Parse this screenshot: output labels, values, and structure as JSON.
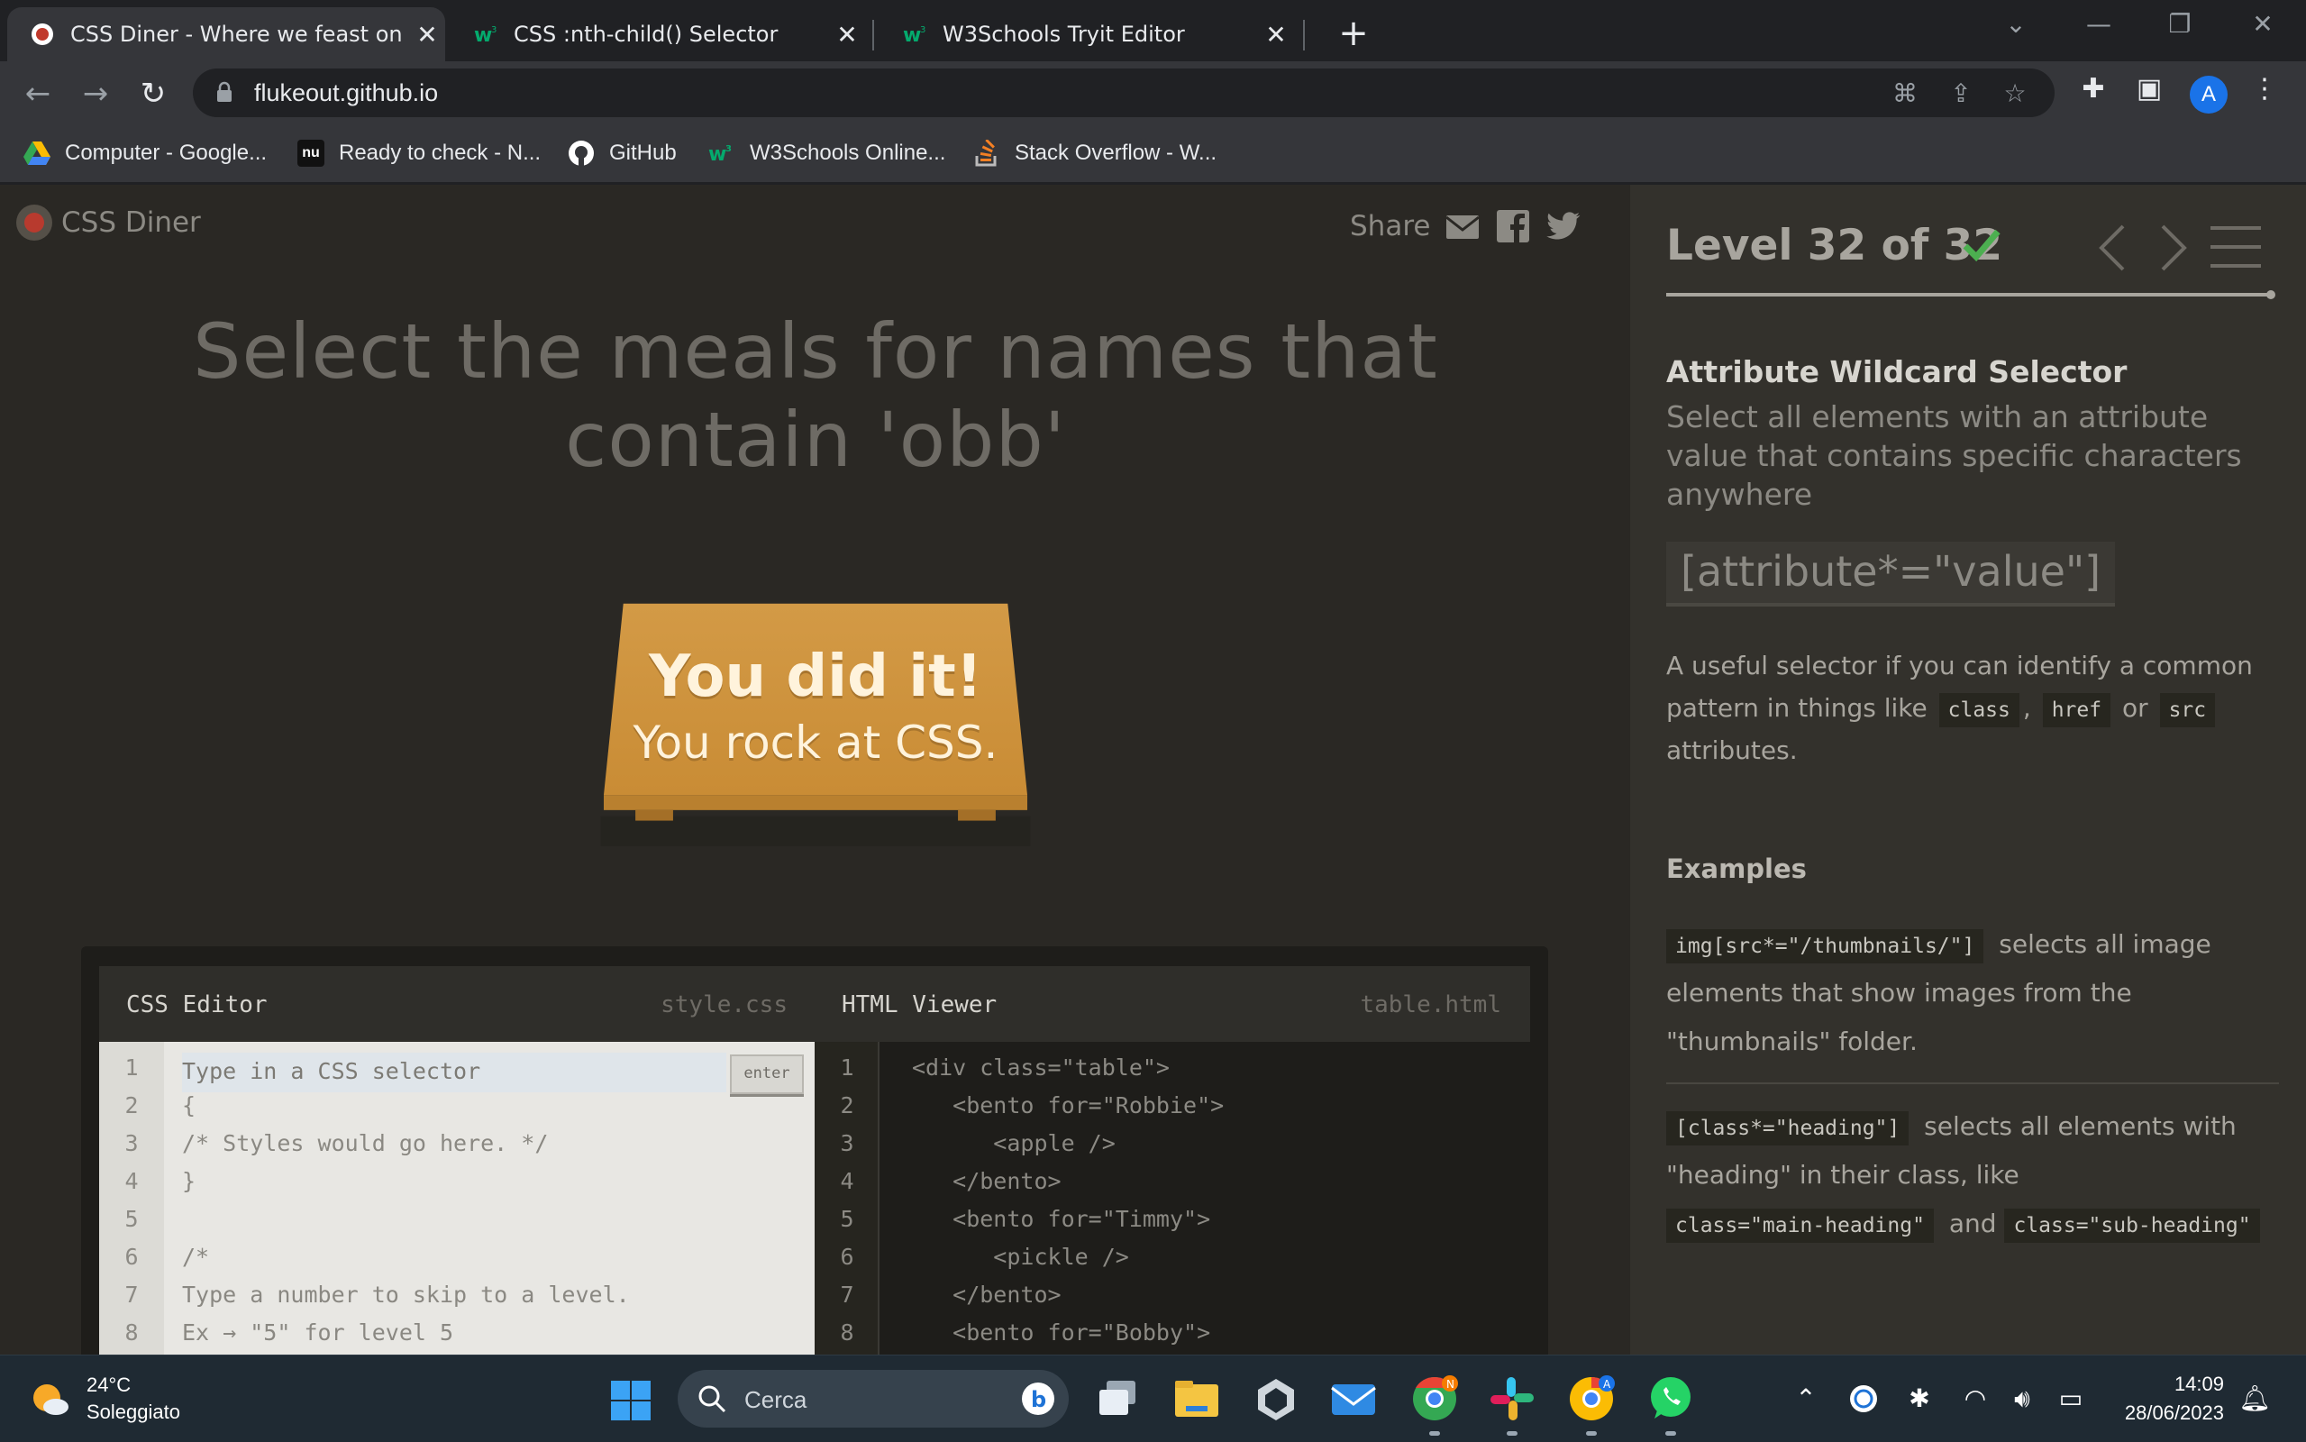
{
  "browser": {
    "tabs": [
      {
        "title": "CSS Diner - Where we feast on C",
        "active": true
      },
      {
        "title": "CSS :nth-child() Selector",
        "active": false
      },
      {
        "title": "W3Schools Tryit Editor",
        "active": false
      }
    ],
    "url": "flukeout.github.io",
    "profile_initial": "A",
    "bookmarks": [
      {
        "label": "Computer - Google..."
      },
      {
        "label": "Ready to check - N...",
        "icon_text": "nu"
      },
      {
        "label": "GitHub"
      },
      {
        "label": "W3Schools Online..."
      },
      {
        "label": "Stack Overflow - W..."
      }
    ]
  },
  "game": {
    "logo": "CSS Diner",
    "share_label": "Share",
    "instruction": "Select the meals for names that contain 'obb'",
    "success_title": "You did it!",
    "success_subtitle": "You rock at CSS.",
    "css_editor": {
      "title": "CSS Editor",
      "filename": "style.css",
      "placeholder": "Type in a CSS selector",
      "enter_label": "enter",
      "line_numbers": [
        "1",
        "2",
        "3",
        "4",
        "5",
        "6",
        "7",
        "8"
      ],
      "lines": [
        "",
        "{",
        "/* Styles would go here. */",
        "}",
        "",
        "/*",
        "Type a number to skip to a level.",
        "Ex → \"5\" for level 5"
      ]
    },
    "html_viewer": {
      "title": "HTML Viewer",
      "filename": "table.html",
      "line_numbers": [
        "1",
        "2",
        "3",
        "4",
        "5",
        "6",
        "7",
        "8"
      ],
      "lines": [
        "<div class=\"table\">",
        "   <bento for=\"Robbie\">",
        "      <apple />",
        "   </bento>",
        "   <bento for=\"Timmy\">",
        "      <pickle />",
        "   </bento>",
        "   <bento for=\"Bobby\">"
      ]
    }
  },
  "sidebar": {
    "level_text": "Level 32 of 32",
    "selector_name": "Attribute Wildcard Selector",
    "description": "Select all elements with an attribute value that contains specific characters anywhere",
    "syntax": "[attribute*=\"value\"]",
    "help_before": "A useful selector if you can identify a common pattern in things like",
    "help_chip1": "class",
    "help_sep1": ",",
    "help_chip2": "href",
    "help_or": "or",
    "help_chip3": "src",
    "help_after": "attributes.",
    "examples_heading": "Examples",
    "example1_code": "img[src*=\"/thumbnails/\"]",
    "example1_text": "selects all image elements that show images from the \"thumbnails\" folder.",
    "example2_code": "[class*=\"heading\"]",
    "example2_text_a": "selects all elements with \"heading\" in their class, like",
    "example2_code_b": "class=\"main-heading\"",
    "example2_and": "and",
    "example2_code_c": "class=\"sub-heading\""
  },
  "taskbar": {
    "temperature": "24°C",
    "weather": "Soleggiato",
    "search_placeholder": "Cerca",
    "time": "14:09",
    "date": "28/06/2023"
  },
  "colors": {
    "accent_check": "#4caf50",
    "table_wood": "#d4993e",
    "game_bg": "#2a2824",
    "sidebar_bg": "#33312c"
  }
}
